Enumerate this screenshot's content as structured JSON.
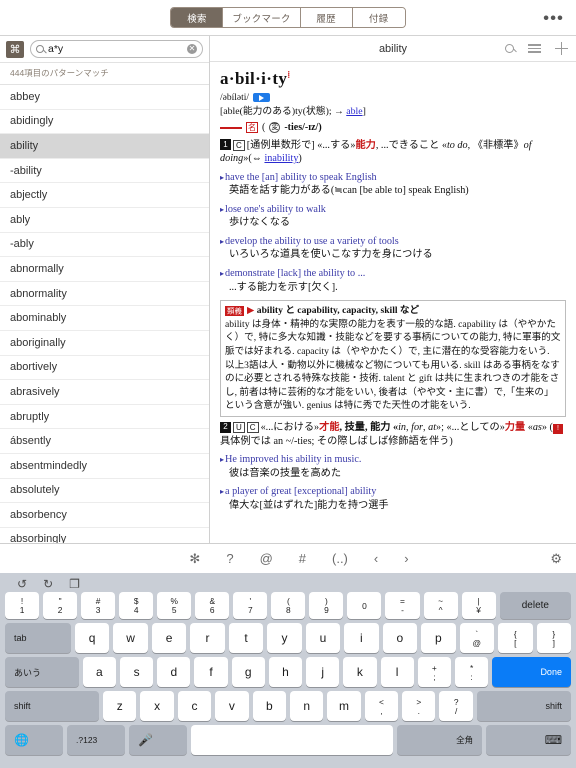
{
  "topbar": {
    "tabs": [
      {
        "label": "検索",
        "active": true
      },
      {
        "label": "ブックマーク",
        "active": false
      },
      {
        "label": "履歴",
        "active": false
      },
      {
        "label": "付録",
        "active": false
      }
    ],
    "more_label": "•••"
  },
  "search": {
    "kanji_button_label": "⌘",
    "value": "a*y",
    "clear_label": "✕",
    "match_count_text": "444項目のパターンマッチ"
  },
  "wordlist": [
    {
      "label": "abbey",
      "selected": false
    },
    {
      "label": "abidingly",
      "selected": false
    },
    {
      "label": "ability",
      "selected": true
    },
    {
      "label": "-ability",
      "selected": false
    },
    {
      "label": "abjectly",
      "selected": false
    },
    {
      "label": "ably",
      "selected": false
    },
    {
      "label": "-ably",
      "selected": false
    },
    {
      "label": "abnormally",
      "selected": false
    },
    {
      "label": "abnormality",
      "selected": false
    },
    {
      "label": "abominably",
      "selected": false
    },
    {
      "label": "aboriginally",
      "selected": false
    },
    {
      "label": "abortively",
      "selected": false
    },
    {
      "label": "abrasively",
      "selected": false
    },
    {
      "label": "abruptly",
      "selected": false
    },
    {
      "label": "ábsently",
      "selected": false
    },
    {
      "label": "absentmindedly",
      "selected": false
    },
    {
      "label": "absolutely",
      "selected": false
    },
    {
      "label": "absorbency",
      "selected": false
    },
    {
      "label": "absorbingly",
      "selected": false
    }
  ],
  "dictionary": {
    "header_title": "ability",
    "headword": "a·bil·i·ty",
    "headword_sup": "⁞",
    "ipa": "/əbíləti/",
    "etymology_pre": "[able(能力のある)ty(状態); → ",
    "etymology_link": "able",
    "etymology_post": "]",
    "pos_label": "名",
    "pos_circle": "変",
    "pos_plural": "-ties/-ɪz/)",
    "pos_paren_open": "(",
    "sense1": {
      "number": "1",
      "cbox": "C",
      "text_a": "[通例単数形で] «...する»",
      "text_red": "能力",
      "text_b": ", ...できること «",
      "text_ital": "to do",
      "text_c": ", 《非標準》",
      "text_ital2": "of doing",
      "text_d": "»(⇔ ",
      "link": "inability",
      "text_e": ")"
    },
    "examples1": [
      {
        "en_parts": "have the [an] ability to speak English",
        "jp": "英語を話す能力がある(≒can [be able to] speak English)"
      },
      {
        "en_parts": "lose one's ability to walk",
        "jp": "歩けなくなる"
      },
      {
        "en_parts": "develop the ability to use a variety of tools",
        "jp": "いろいろな道具を使いこなす力を身につける"
      },
      {
        "en_parts": "demonstrate [lack] the ability to ...",
        "jp": "...する能力を示す[欠く]."
      }
    ],
    "synonym": {
      "tag": "類義",
      "headline": "ability と capability, capacity, skill など",
      "body": "ability は身体・精神的な実際の能力を表す一般的な語. capability は（ややかたく）で, 特に多大な知識・技能などを要する事柄についての能力, 特に軍事的文脈では好まれる. capacity は（ややかたく）で, 主に潜在的な受容能力をいう. 以上3語は人・動物以外に機械など物についても用いる. skill はある事柄をなすのに必要とされる特殊な技能・技術. talent と gift は共に生まれつきの才能をさし, 前者は特に芸術的な才能をいい, 後者は（やや文・主に書）で,「生来の」という含意が強い. genius は特に秀でた天性の才能をいう."
    },
    "sense2": {
      "number": "2",
      "ubox": "U",
      "cbox": "C",
      "text_a": "«...における»",
      "text_red": "才能",
      "text_b": ", 技量, 能力 «",
      "text_ital": "in",
      "text_c": ", ",
      "text_ital2": "for",
      "text_d": ", ",
      "text_ital3": "at",
      "text_e": "»; «...としての»",
      "text_red2": "力量",
      "text_f": " «",
      "text_ital4": "as",
      "text_g": "» (",
      "flag": "!",
      "text_h": " 具体例では an ~/-ties; その際しばしば修飾語を伴う)"
    },
    "examples2": [
      {
        "en_parts": "He improved his ability in music.",
        "jp": "彼は音楽の技量を高めた"
      },
      {
        "en_parts": "a player of great [exceptional] ability",
        "jp": "偉大な[並はずれた]能力を持つ選手"
      }
    ]
  },
  "keyboard_toolbar": {
    "items": [
      "✻",
      "?",
      "@",
      "#",
      "(..)",
      "‹",
      "›"
    ],
    "gear": "⚙"
  },
  "keyboard": {
    "edit_row": [
      "↺",
      "↻",
      "❐"
    ],
    "number_row": [
      {
        "top": "!",
        "bot": "1"
      },
      {
        "top": "\"",
        "bot": "2"
      },
      {
        "top": "#",
        "bot": "3"
      },
      {
        "top": "$",
        "bot": "4"
      },
      {
        "top": "%",
        "bot": "5"
      },
      {
        "top": "&",
        "bot": "6"
      },
      {
        "top": "'",
        "bot": "7"
      },
      {
        "top": "(",
        "bot": "8"
      },
      {
        "top": ")",
        "bot": "9"
      },
      {
        "top": "",
        "bot": "0"
      },
      {
        "top": "=",
        "bot": "-"
      },
      {
        "top": "~",
        "bot": "^"
      },
      {
        "top": "|",
        "bot": "¥"
      }
    ],
    "delete_label": "delete",
    "row_q": [
      "q",
      "w",
      "e",
      "r",
      "t",
      "y",
      "u",
      "i",
      "o",
      "p"
    ],
    "row_q_dual": [
      {
        "top": "`",
        "bot": "@"
      },
      {
        "top": "{",
        "bot": "["
      },
      {
        "top": "}",
        "bot": "]"
      }
    ],
    "tab_label": "tab",
    "row_a": [
      "a",
      "s",
      "d",
      "f",
      "g",
      "h",
      "j",
      "k",
      "l"
    ],
    "row_a_dual": [
      {
        "top": "+",
        "bot": ";"
      },
      {
        "top": "*",
        "bot": ":"
      }
    ],
    "aiu_label": "あいう",
    "done_label": "Done",
    "row_z": [
      "z",
      "x",
      "c",
      "v",
      "b",
      "n",
      "m"
    ],
    "row_z_dual": [
      {
        "top": "<",
        "bot": ","
      },
      {
        "top": ">",
        "bot": "."
      },
      {
        "top": "?",
        "bot": "/"
      }
    ],
    "shift_label": "shift",
    "globe_label": "🌐",
    "num_label": ".?123",
    "mic_label": "🎤",
    "space_label": "",
    "zenkaku_label": "全角",
    "dismiss_label": "⌨"
  },
  "colors": {
    "accent_brown": "#756a5f",
    "highlight_blue": "#0a7cf7",
    "red": "#c81a1a",
    "example_blue": "#3a3aa8",
    "keyboard_bg": "#c9ced6"
  }
}
